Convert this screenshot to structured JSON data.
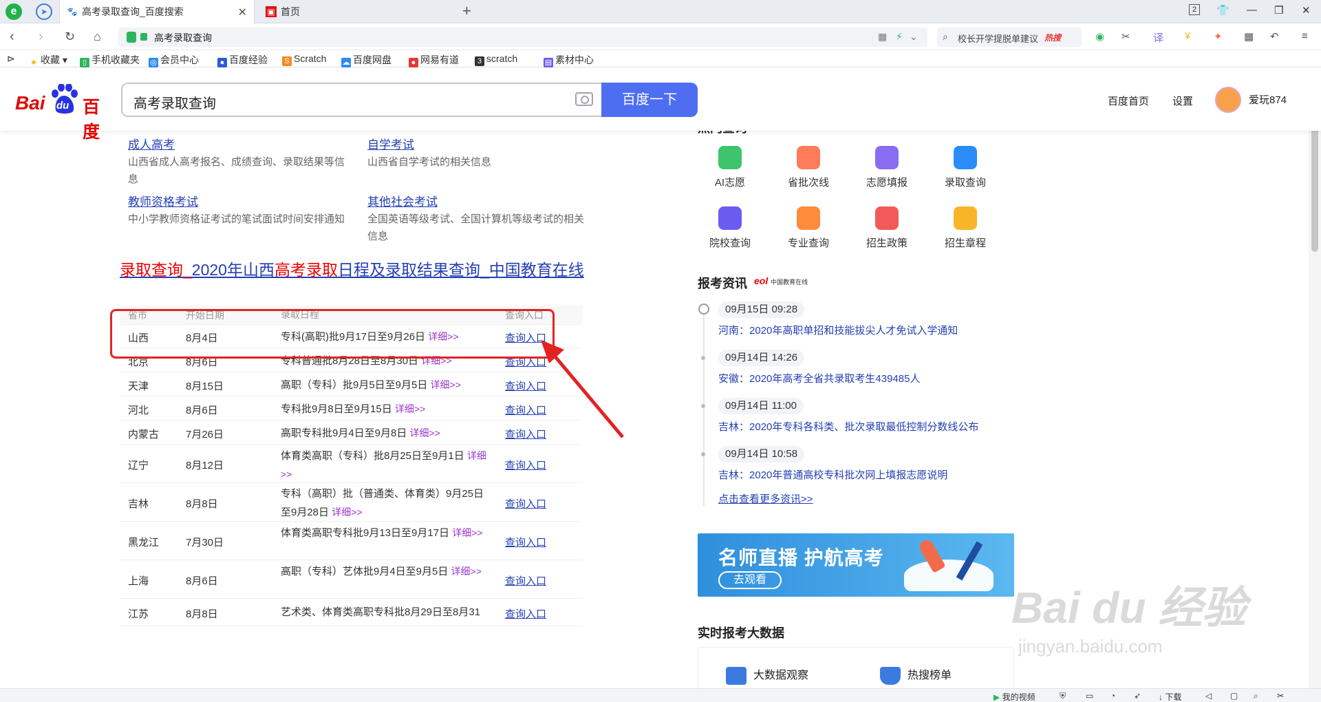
{
  "browser": {
    "tabs": [
      {
        "title": "高考录取查询_百度搜索",
        "active": true
      },
      {
        "title": "首页",
        "active": false
      }
    ],
    "address": "高考录取查询",
    "search_box": {
      "text": "校长开学提脱单建议",
      "badge": "热搜"
    },
    "tab_count": "2",
    "bookmarks": [
      "收藏",
      "手机收藏夹",
      "会员中心",
      "百度经验",
      "Scratch",
      "百度网盘",
      "网易有道",
      "scratch",
      "素材中心"
    ]
  },
  "baidu": {
    "logo_bai": "Bai",
    "logo_du": "du",
    "logo_cn": "百度",
    "query": "高考录取查询",
    "search_button": "百度一下",
    "nav": {
      "home": "百度首页",
      "settings": "设置"
    },
    "username": "爱玩874"
  },
  "links": [
    {
      "title": "成人高考",
      "desc": "山西省成人高考报名、成绩查询、录取结果等信息"
    },
    {
      "title": "自学考试",
      "desc": "山西省自学考试的相关信息"
    },
    {
      "title": "教师资格考试",
      "desc": "中小学教师资格证考试的笔试面试时间安排通知"
    },
    {
      "title": "其他社会考试",
      "desc": "全国英语等级考试、全国计算机等级考试的相关信息"
    }
  ],
  "result": {
    "title_a": "录取查询_",
    "title_b": "2020年山西",
    "title_c": "高考录取",
    "title_d": "日程及录取结果查询_中国教育在线"
  },
  "table": {
    "headers": [
      "省市",
      "开始日期",
      "录取日程",
      "查询入口"
    ],
    "rows": [
      {
        "prov": "山西",
        "date": "8月4日",
        "sched": "专科(高职)批9月17日至9月26日",
        "more": "详细>>",
        "link": "查询入口"
      },
      {
        "prov": "北京",
        "date": "8月6日",
        "sched": "专科普通批8月28日至8月30日",
        "more": "详细>>",
        "link": "查询入口"
      },
      {
        "prov": "天津",
        "date": "8月15日",
        "sched": "高职（专科）批9月5日至9月5日",
        "more": "详细>>",
        "link": "查询入口"
      },
      {
        "prov": "河北",
        "date": "8月6日",
        "sched": "专科批9月8日至9月15日",
        "more": "详细>>",
        "link": "查询入口"
      },
      {
        "prov": "内蒙古",
        "date": "7月26日",
        "sched": "高职专科批9月4日至9月8日",
        "more": "详细>>",
        "link": "查询入口"
      },
      {
        "prov": "辽宁",
        "date": "8月12日",
        "sched": "体育类高职（专科）批8月25日至9月1日",
        "more": "详细>>",
        "link": "查询入口"
      },
      {
        "prov": "吉林",
        "date": "8月8日",
        "sched": "专科（高职）批（普通类、体育类）9月25日至9月28日",
        "more": "详细>>",
        "link": "查询入口"
      },
      {
        "prov": "黑龙江",
        "date": "7月30日",
        "sched": "体育类高职专科批9月13日至9月17日",
        "more": "详细>>",
        "link": "查询入口"
      },
      {
        "prov": "上海",
        "date": "8月6日",
        "sched": "高职（专科）艺体批9月4日至9月5日",
        "more": "详细>>",
        "link": "查询入口"
      },
      {
        "prov": "江苏",
        "date": "8月8日",
        "sched": "艺术类、体育类高职专科批8月29日至8月31",
        "more": "",
        "link": "查询入口"
      }
    ]
  },
  "services": {
    "title": "热门查询",
    "items": [
      {
        "label": "AI志愿",
        "color": "#3ec46d",
        "icon": "bulb-icon"
      },
      {
        "label": "省批次线",
        "color": "#ff7b5a",
        "icon": "trend-icon"
      },
      {
        "label": "志愿填报",
        "color": "#8a6cf0",
        "icon": "pen-icon"
      },
      {
        "label": "录取查询",
        "color": "#2b8cf7",
        "icon": "folder-icon"
      },
      {
        "label": "院校查询",
        "color": "#6b5cf0",
        "icon": "school-icon"
      },
      {
        "label": "专业查询",
        "color": "#ff8c3a",
        "icon": "medal-icon"
      },
      {
        "label": "招生政策",
        "color": "#f25a5a",
        "icon": "book-icon"
      },
      {
        "label": "招生章程",
        "color": "#f8b52a",
        "icon": "list-icon"
      }
    ]
  },
  "news": {
    "title": "报考资讯",
    "source_logo": "eol",
    "source_name": "中国教育在线",
    "items": [
      {
        "time": "09月15日 09:28",
        "region": "河南：",
        "text": "2020年高职单招和技能拔尖人才免试入学通知"
      },
      {
        "time": "09月14日 14:26",
        "region": "安徽：",
        "text": "2020年高考全省共录取考生439485人"
      },
      {
        "time": "09月14日 11:00",
        "region": "吉林：",
        "text": "2020年专科各科类、批次录取最低控制分数线公布"
      },
      {
        "time": "09月14日 10:58",
        "region": "吉林：",
        "text": "2020年普通高校专科批次网上填报志愿说明"
      }
    ],
    "more": "点击查看更多资讯>>"
  },
  "banner": {
    "title": "名师直播 护航高考",
    "button": "去观看"
  },
  "bigdata": {
    "title": "实时报考大数据",
    "items": [
      "大数据观察",
      "热搜榜单"
    ]
  },
  "watermark": {
    "logo": "Bai du 经验",
    "url": "jingyan.baidu.com"
  },
  "statusbar": {
    "video": "我的视频",
    "download": "下载"
  },
  "colors": {
    "baidu_red": "#e10602",
    "baidu_blue": "#4e6ef2",
    "link_blue": "#2440b3",
    "highlight_red": "#e32222"
  }
}
